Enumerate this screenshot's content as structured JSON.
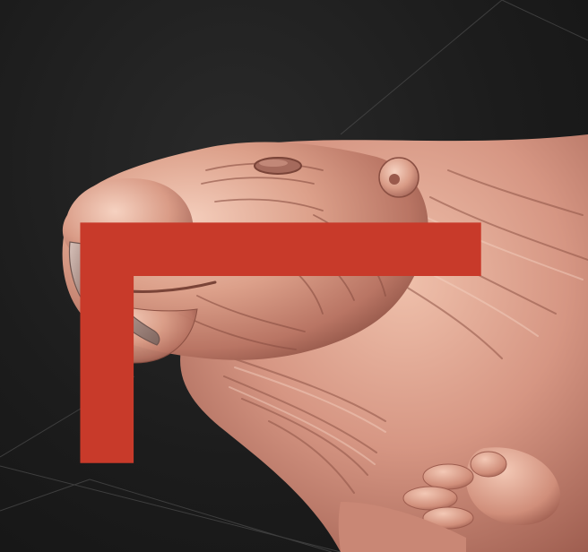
{
  "scene": {
    "background_color": "#1c1c1c",
    "grid_color": "#4a4a4a",
    "clay_base_color": "#d79a86",
    "clay_shadow_color": "#8a4f42",
    "clay_highlight_color": "#f3c9b6",
    "tusk_color": "#b59a92",
    "corner_marker_color": "#c83a2a"
  },
  "icons": {
    "corner_marker": "viewport-corner-marker-icon"
  }
}
